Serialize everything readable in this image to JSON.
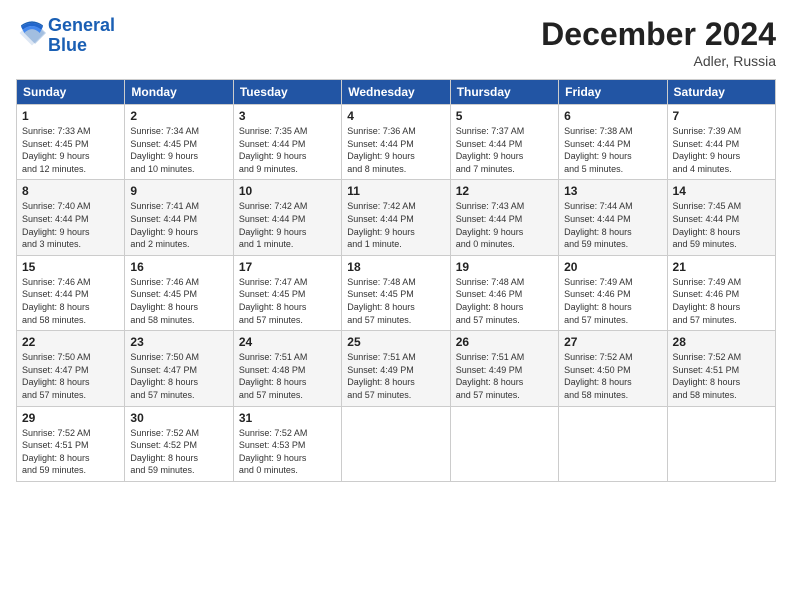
{
  "header": {
    "logo_line1": "General",
    "logo_line2": "Blue",
    "month": "December 2024",
    "location": "Adler, Russia"
  },
  "days_of_week": [
    "Sunday",
    "Monday",
    "Tuesday",
    "Wednesday",
    "Thursday",
    "Friday",
    "Saturday"
  ],
  "weeks": [
    [
      {
        "day": 1,
        "info": "Sunrise: 7:33 AM\nSunset: 4:45 PM\nDaylight: 9 hours\nand 12 minutes."
      },
      {
        "day": 2,
        "info": "Sunrise: 7:34 AM\nSunset: 4:45 PM\nDaylight: 9 hours\nand 10 minutes."
      },
      {
        "day": 3,
        "info": "Sunrise: 7:35 AM\nSunset: 4:44 PM\nDaylight: 9 hours\nand 9 minutes."
      },
      {
        "day": 4,
        "info": "Sunrise: 7:36 AM\nSunset: 4:44 PM\nDaylight: 9 hours\nand 8 minutes."
      },
      {
        "day": 5,
        "info": "Sunrise: 7:37 AM\nSunset: 4:44 PM\nDaylight: 9 hours\nand 7 minutes."
      },
      {
        "day": 6,
        "info": "Sunrise: 7:38 AM\nSunset: 4:44 PM\nDaylight: 9 hours\nand 5 minutes."
      },
      {
        "day": 7,
        "info": "Sunrise: 7:39 AM\nSunset: 4:44 PM\nDaylight: 9 hours\nand 4 minutes."
      }
    ],
    [
      {
        "day": 8,
        "info": "Sunrise: 7:40 AM\nSunset: 4:44 PM\nDaylight: 9 hours\nand 3 minutes."
      },
      {
        "day": 9,
        "info": "Sunrise: 7:41 AM\nSunset: 4:44 PM\nDaylight: 9 hours\nand 2 minutes."
      },
      {
        "day": 10,
        "info": "Sunrise: 7:42 AM\nSunset: 4:44 PM\nDaylight: 9 hours\nand 1 minute."
      },
      {
        "day": 11,
        "info": "Sunrise: 7:42 AM\nSunset: 4:44 PM\nDaylight: 9 hours\nand 1 minute."
      },
      {
        "day": 12,
        "info": "Sunrise: 7:43 AM\nSunset: 4:44 PM\nDaylight: 9 hours\nand 0 minutes."
      },
      {
        "day": 13,
        "info": "Sunrise: 7:44 AM\nSunset: 4:44 PM\nDaylight: 8 hours\nand 59 minutes."
      },
      {
        "day": 14,
        "info": "Sunrise: 7:45 AM\nSunset: 4:44 PM\nDaylight: 8 hours\nand 59 minutes."
      }
    ],
    [
      {
        "day": 15,
        "info": "Sunrise: 7:46 AM\nSunset: 4:44 PM\nDaylight: 8 hours\nand 58 minutes."
      },
      {
        "day": 16,
        "info": "Sunrise: 7:46 AM\nSunset: 4:45 PM\nDaylight: 8 hours\nand 58 minutes."
      },
      {
        "day": 17,
        "info": "Sunrise: 7:47 AM\nSunset: 4:45 PM\nDaylight: 8 hours\nand 57 minutes."
      },
      {
        "day": 18,
        "info": "Sunrise: 7:48 AM\nSunset: 4:45 PM\nDaylight: 8 hours\nand 57 minutes."
      },
      {
        "day": 19,
        "info": "Sunrise: 7:48 AM\nSunset: 4:46 PM\nDaylight: 8 hours\nand 57 minutes."
      },
      {
        "day": 20,
        "info": "Sunrise: 7:49 AM\nSunset: 4:46 PM\nDaylight: 8 hours\nand 57 minutes."
      },
      {
        "day": 21,
        "info": "Sunrise: 7:49 AM\nSunset: 4:46 PM\nDaylight: 8 hours\nand 57 minutes."
      }
    ],
    [
      {
        "day": 22,
        "info": "Sunrise: 7:50 AM\nSunset: 4:47 PM\nDaylight: 8 hours\nand 57 minutes."
      },
      {
        "day": 23,
        "info": "Sunrise: 7:50 AM\nSunset: 4:47 PM\nDaylight: 8 hours\nand 57 minutes."
      },
      {
        "day": 24,
        "info": "Sunrise: 7:51 AM\nSunset: 4:48 PM\nDaylight: 8 hours\nand 57 minutes."
      },
      {
        "day": 25,
        "info": "Sunrise: 7:51 AM\nSunset: 4:49 PM\nDaylight: 8 hours\nand 57 minutes."
      },
      {
        "day": 26,
        "info": "Sunrise: 7:51 AM\nSunset: 4:49 PM\nDaylight: 8 hours\nand 57 minutes."
      },
      {
        "day": 27,
        "info": "Sunrise: 7:52 AM\nSunset: 4:50 PM\nDaylight: 8 hours\nand 58 minutes."
      },
      {
        "day": 28,
        "info": "Sunrise: 7:52 AM\nSunset: 4:51 PM\nDaylight: 8 hours\nand 58 minutes."
      }
    ],
    [
      {
        "day": 29,
        "info": "Sunrise: 7:52 AM\nSunset: 4:51 PM\nDaylight: 8 hours\nand 59 minutes."
      },
      {
        "day": 30,
        "info": "Sunrise: 7:52 AM\nSunset: 4:52 PM\nDaylight: 8 hours\nand 59 minutes."
      },
      {
        "day": 31,
        "info": "Sunrise: 7:52 AM\nSunset: 4:53 PM\nDaylight: 9 hours\nand 0 minutes."
      },
      null,
      null,
      null,
      null
    ]
  ]
}
